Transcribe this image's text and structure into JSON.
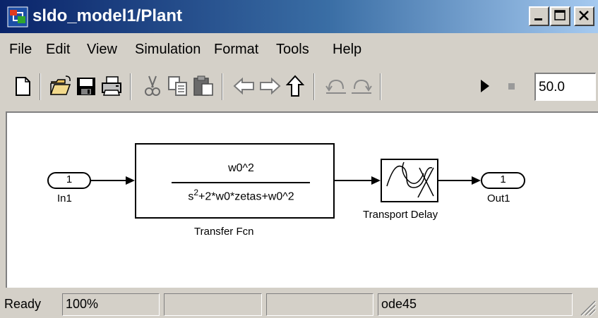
{
  "window": {
    "title": "sldo_model1/Plant"
  },
  "menu": {
    "items": [
      "File",
      "Edit",
      "View",
      "Simulation",
      "Format",
      "Tools",
      "Help"
    ]
  },
  "toolbar": {
    "stop_time": "50.0",
    "icons": [
      "new-icon",
      "open-icon",
      "save-icon",
      "print-icon",
      "cut-icon",
      "copy-icon",
      "paste-icon",
      "back-icon",
      "forward-icon",
      "up-icon",
      "undo-icon",
      "redo-icon",
      "start-icon",
      "stop-icon"
    ]
  },
  "diagram": {
    "inport": {
      "number": "1",
      "label": "In1"
    },
    "transfer_fcn": {
      "numerator": "w0^2",
      "denominator_base": "s",
      "denominator_exp": "2",
      "denominator_rest": "+2*w0*zetas+w0^2",
      "label": "Transfer Fcn"
    },
    "transport_delay": {
      "label": "Transport Delay"
    },
    "outport": {
      "number": "1",
      "label": "Out1"
    }
  },
  "status": {
    "state": "Ready",
    "zoom": "100%",
    "field2": "",
    "field3": "",
    "solver": "ode45"
  }
}
